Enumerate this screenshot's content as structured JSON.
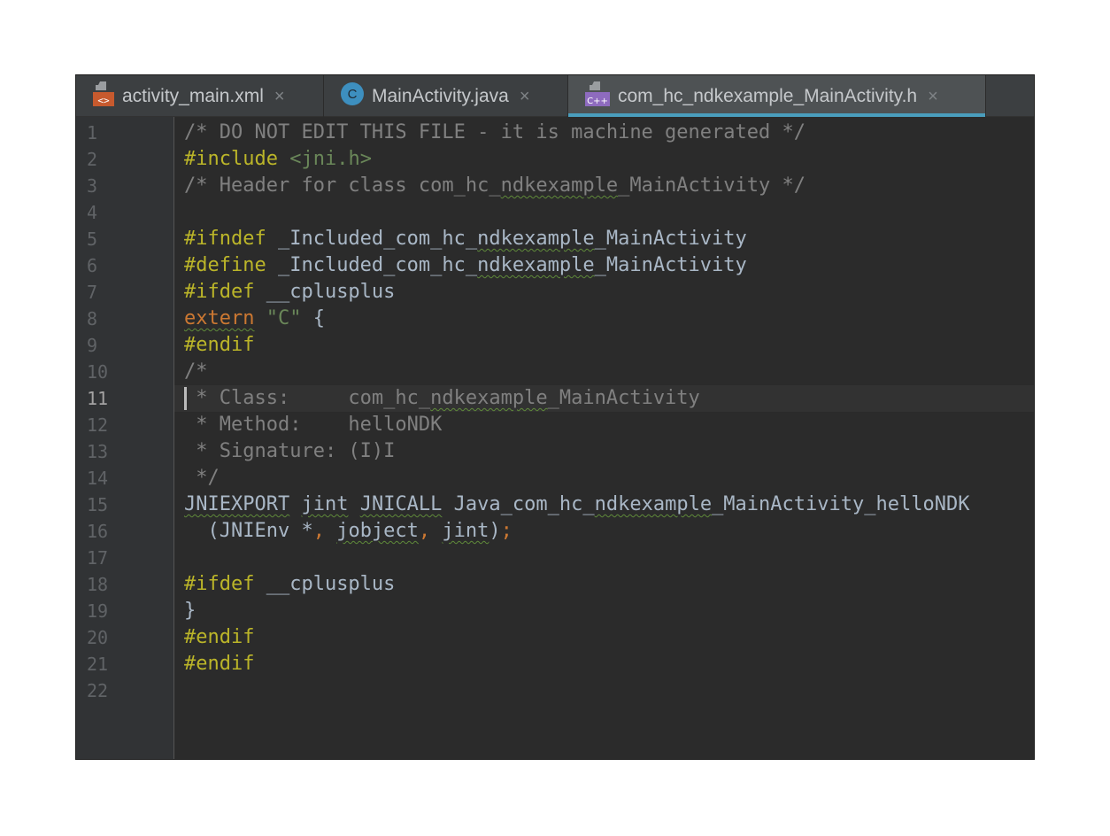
{
  "tabs": [
    {
      "label": "activity_main.xml",
      "icon": "xml-file-icon",
      "active": false
    },
    {
      "label": "MainActivity.java",
      "icon": "java-class-icon",
      "active": false
    },
    {
      "label": "com_hc_ndkexample_MainActivity.h",
      "icon": "cpp-header-file-icon",
      "active": true
    }
  ],
  "tab_close_glyph": "×",
  "icon_text": {
    "xml": "<>",
    "java": "C",
    "cpp": "C++"
  },
  "editor": {
    "current_line": 11,
    "lines": [
      {
        "n": "1",
        "tokens": [
          [
            "c",
            "/* DO NOT EDIT THIS FILE - it is machine generated */"
          ]
        ]
      },
      {
        "n": "2",
        "tokens": [
          [
            "p",
            "#include "
          ],
          [
            "i",
            "<jni.h>"
          ]
        ]
      },
      {
        "n": "3",
        "tokens": [
          [
            "c",
            "/* Header for class com_hc_"
          ],
          [
            "cs",
            "ndkexample"
          ],
          [
            "c",
            "_MainActivity */"
          ]
        ]
      },
      {
        "n": "4",
        "tokens": []
      },
      {
        "n": "5",
        "tokens": [
          [
            "p",
            "#ifndef "
          ],
          [
            "t",
            "_Included_com_hc_"
          ],
          [
            "ts",
            "ndkexample"
          ],
          [
            "t",
            "_MainActivity"
          ]
        ]
      },
      {
        "n": "6",
        "tokens": [
          [
            "p",
            "#define "
          ],
          [
            "t",
            "_Included_com_hc_"
          ],
          [
            "ts",
            "ndkexample"
          ],
          [
            "t",
            "_MainActivity"
          ]
        ]
      },
      {
        "n": "7",
        "tokens": [
          [
            "p",
            "#ifdef "
          ],
          [
            "t",
            "__cplusplus"
          ]
        ]
      },
      {
        "n": "8",
        "tokens": [
          [
            "ks",
            "extern"
          ],
          [
            "t",
            " "
          ],
          [
            "s",
            "\"C\""
          ],
          [
            "t",
            " {"
          ]
        ]
      },
      {
        "n": "9",
        "tokens": [
          [
            "p",
            "#endif"
          ]
        ]
      },
      {
        "n": "10",
        "tokens": [
          [
            "c",
            "/*"
          ]
        ]
      },
      {
        "n": "11",
        "tokens": [
          [
            "c",
            " * Class:     com_hc_"
          ],
          [
            "cs",
            "ndkexample"
          ],
          [
            "c",
            "_MainActivity"
          ]
        ]
      },
      {
        "n": "12",
        "tokens": [
          [
            "c",
            " * Method:    helloNDK"
          ]
        ]
      },
      {
        "n": "13",
        "tokens": [
          [
            "c",
            " * Signature: (I)I"
          ]
        ]
      },
      {
        "n": "14",
        "tokens": [
          [
            "c",
            " */"
          ]
        ]
      },
      {
        "n": "15",
        "tokens": [
          [
            "ts",
            "JNIEXPORT"
          ],
          [
            "t",
            " "
          ],
          [
            "ts",
            "jint"
          ],
          [
            "t",
            " "
          ],
          [
            "ts",
            "JNICALL"
          ],
          [
            "t",
            " Java_com_hc_"
          ],
          [
            "ts",
            "ndkexample"
          ],
          [
            "t",
            "_MainActivity_helloNDK"
          ]
        ]
      },
      {
        "n": "16",
        "tokens": [
          [
            "t",
            "  (JNIEnv *"
          ],
          [
            "o",
            ", "
          ],
          [
            "ts",
            "jobject"
          ],
          [
            "o",
            ", "
          ],
          [
            "ts",
            "jint"
          ],
          [
            "t",
            ")"
          ],
          [
            "o",
            ";"
          ]
        ]
      },
      {
        "n": "17",
        "tokens": []
      },
      {
        "n": "18",
        "tokens": [
          [
            "p",
            "#ifdef "
          ],
          [
            "t",
            "__cplusplus"
          ]
        ]
      },
      {
        "n": "19",
        "tokens": [
          [
            "t",
            "}"
          ]
        ]
      },
      {
        "n": "20",
        "tokens": [
          [
            "p",
            "#endif"
          ]
        ]
      },
      {
        "n": "21",
        "tokens": [
          [
            "p",
            "#endif"
          ]
        ]
      },
      {
        "n": "22",
        "tokens": []
      }
    ]
  }
}
